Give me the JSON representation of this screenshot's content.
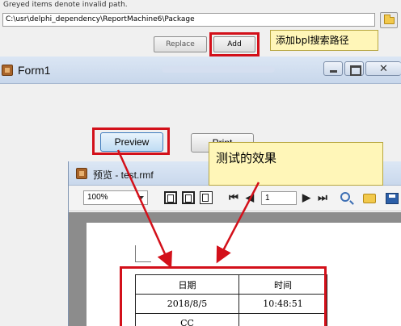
{
  "library_dialog": {
    "hint": "Greyed items denote invalid path.",
    "path_value": "C:\\usr\\delphi_dependency\\ReportMachine6\\Package",
    "replace_label": "Replace",
    "add_label": "Add",
    "annotation": "添加bpl搜索路径"
  },
  "form1": {
    "title": "Form1",
    "preview_label": "Preview",
    "print_label": "Print",
    "annotation": "测试的效果"
  },
  "preview_window": {
    "title": "预览 - test.rmf",
    "zoom": "100%",
    "page_number": "1",
    "icons": [
      "whole-page-icon",
      "page-width-icon",
      "single-page-icon",
      "first-page-icon",
      "prev-page-icon",
      "next-page-icon",
      "last-page-icon",
      "search-icon",
      "open-icon",
      "save-icon"
    ]
  },
  "report_table": {
    "headers": [
      "日期",
      "时间"
    ],
    "rows": [
      [
        "2018/8/5",
        "10:48:51"
      ],
      [
        "CC",
        ""
      ]
    ]
  },
  "colors": {
    "annotation_red": "#d3101a",
    "callout_yellow": "#fff6b8"
  }
}
